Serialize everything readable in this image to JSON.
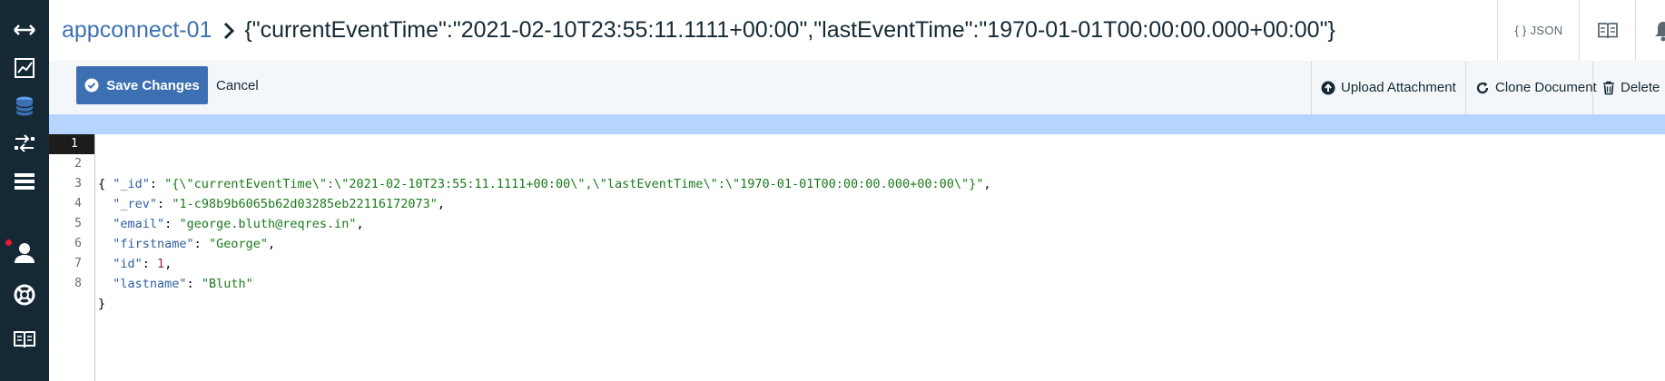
{
  "header": {
    "database": "appconnect-01",
    "document_title": "{\"currentEventTime\":\"2021-02-10T23:55:11.1111+00:00\",\"lastEventTime\":\"1970-01-01T00:00:00.000+00:00\"}",
    "json_label": "{ } JSON"
  },
  "toolbar": {
    "save_label": "Save Changes",
    "cancel_label": "Cancel",
    "upload_label": "Upload Attachment",
    "clone_label": "Clone Document",
    "delete_label": "Delete"
  },
  "editor": {
    "lines": [
      {
        "num": "1",
        "text": "{"
      },
      {
        "num": "2",
        "key": "\"_id\"",
        "value": "\"{\\\"currentEventTime\\\":\\\"2021-02-10T23:55:11.1111+00:00\\\",\\\"lastEventTime\\\":\\\"1970-01-01T00:00:00.000+00:00\\\"}\"",
        "tail": ","
      },
      {
        "num": "3",
        "key": "\"_rev\"",
        "value": "\"1-c98b9b6065b62d03285eb22116172073\"",
        "tail": ","
      },
      {
        "num": "4",
        "key": "\"email\"",
        "value": "\"george.bluth@reqres.in\"",
        "tail": ","
      },
      {
        "num": "5",
        "key": "\"firstname\"",
        "value": "\"George\"",
        "tail": ","
      },
      {
        "num": "6",
        "key": "\"id\"",
        "value": "1",
        "tail": ","
      },
      {
        "num": "7",
        "key": "\"lastname\"",
        "value": "\"Bluth\"",
        "tail": ""
      },
      {
        "num": "8",
        "text": "}"
      }
    ]
  },
  "colors": {
    "nav_bg": "#152935",
    "accent": "#3d70b2",
    "active_line": "#b5d5ff"
  }
}
